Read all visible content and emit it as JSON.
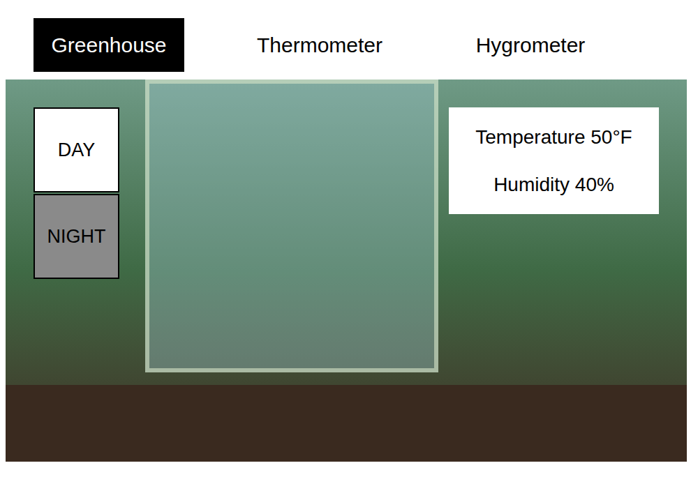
{
  "tabs": [
    {
      "label": "Greenhouse",
      "selected": true
    },
    {
      "label": "Thermometer",
      "selected": false
    },
    {
      "label": "Hygrometer",
      "selected": false
    }
  ],
  "modes": [
    {
      "label": "DAY",
      "selected": true
    },
    {
      "label": "NIGHT",
      "selected": false
    }
  ],
  "readings": [
    "Temperature 50°F",
    "Humidity 40%"
  ]
}
